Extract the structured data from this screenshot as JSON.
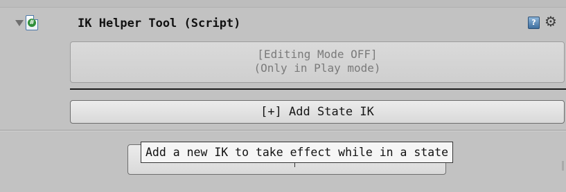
{
  "component": {
    "title": "IK Helper Tool (Script)",
    "foldout_icon": "triangle-down-icon",
    "script_icon": "csharp-script-icon",
    "script_glyph": "#",
    "help_icon": "help-book-icon",
    "help_glyph": "?",
    "settings_icon": "gear-icon",
    "settings_glyph": "⚙"
  },
  "mode_button": {
    "line1": "[Editing Mode OFF]",
    "line2": "(Only in Play mode)"
  },
  "add_button": {
    "label": "[+] Add State IK"
  },
  "tooltip": {
    "text": "Add a new IK to take effect while in a state"
  },
  "colors": {
    "background": "#c2c2c2",
    "button": "#dcdcdc",
    "tooltip_bg": "#f6f6f6"
  }
}
